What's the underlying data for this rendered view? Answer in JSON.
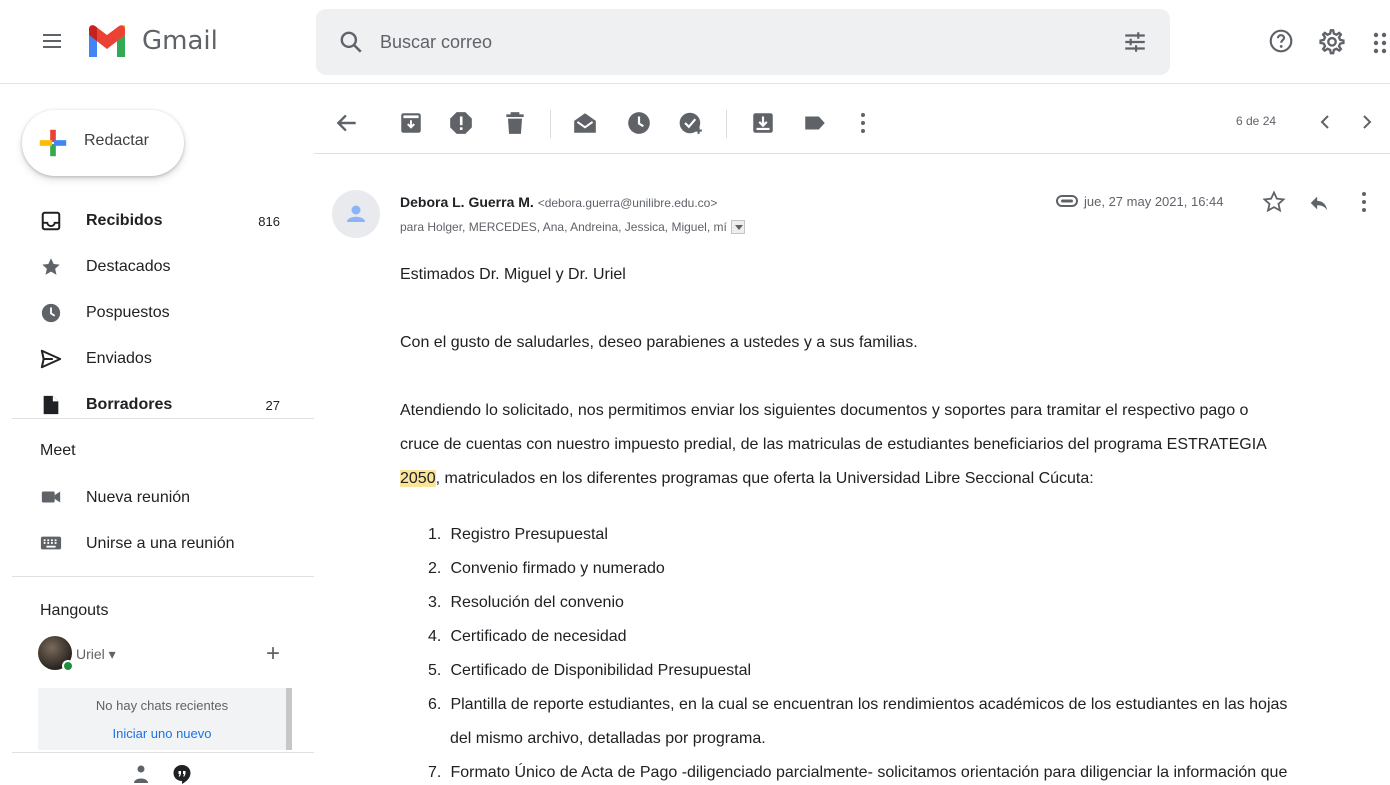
{
  "header": {
    "app_name": "Gmail",
    "search_placeholder": "Buscar correo"
  },
  "sidebar": {
    "compose_label": "Redactar",
    "items": [
      {
        "label": "Recibidos",
        "count": "816",
        "icon": "inbox-icon"
      },
      {
        "label": "Destacados",
        "count": "",
        "icon": "star-icon"
      },
      {
        "label": "Pospuestos",
        "count": "",
        "icon": "clock-icon"
      },
      {
        "label": "Enviados",
        "count": "",
        "icon": "send-icon"
      },
      {
        "label": "Borradores",
        "count": "27",
        "icon": "draft-icon"
      }
    ],
    "meet": {
      "title": "Meet",
      "items": [
        {
          "label": "Nueva reunión",
          "icon": "video-icon"
        },
        {
          "label": "Unirse a una reunión",
          "icon": "keyboard-icon"
        }
      ]
    },
    "hangouts": {
      "title": "Hangouts",
      "user_name": "Uriel",
      "empty_text": "No hay chats recientes",
      "start_link": "Iniciar uno nuevo"
    }
  },
  "toolbar": {
    "pager": "6 de 24"
  },
  "message": {
    "sender_name": "Debora L. Guerra M.",
    "sender_email": "<debora.guerra@unilibre.edu.co>",
    "recipients": "para Holger, MERCEDES, Ana, Andreina, Jessica, Miguel, mí",
    "date": "jue, 27 may 2021, 16:44",
    "greeting": "Estimados Dr. Miguel y Dr. Uriel",
    "paragraph1": "Con el gusto de saludarles, deseo parabienes a ustedes y a sus familias.",
    "paragraph2_line1": "Atendiendo lo solicitado, nos permitimos enviar los siguientes documentos y soportes para tramitar el respectivo pago o",
    "paragraph2_line2": "cruce de cuentas con nuestro impuesto predial, de las matriculas de estudiantes beneficiarios del programa ESTRATEGIA",
    "paragraph2_highlight": "2050",
    "paragraph2_line3": ", matriculados en los diferentes programas que oferta la Universidad Libre Seccional Cúcuta:",
    "documents": [
      {
        "num": "1.",
        "text": "Registro Presupuestal"
      },
      {
        "num": "2.",
        "text": "Convenio firmado y numerado"
      },
      {
        "num": "3.",
        "text": "Resolución del convenio"
      },
      {
        "num": "4.",
        "text": "Certificado de necesidad"
      },
      {
        "num": "5.",
        "text": "Certificado de Disponibilidad Presupuestal"
      },
      {
        "num": "6.",
        "text": "Plantilla de reporte estudiantes, en la cual se encuentran los rendimientos académicos de los estudiantes en las hojas",
        "text2": "del mismo archivo, detalladas por programa."
      },
      {
        "num": "7.",
        "text": "Formato Único de Acta de Pago -diligenciado parcialmente- solicitamos orientación para diligenciar la información que"
      }
    ]
  },
  "colors": {
    "accent_blue": "#1a73e8",
    "highlight": "#fbe39a",
    "online_green": "#1e8e3e"
  }
}
